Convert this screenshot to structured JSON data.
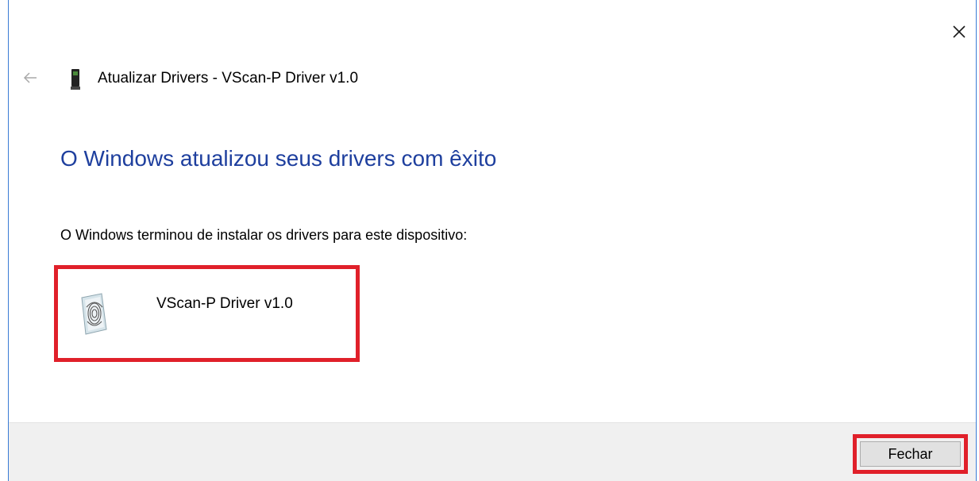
{
  "header": {
    "title": "Atualizar Drivers - VScan-P Driver v1.0"
  },
  "main": {
    "heading": "O Windows atualizou seus drivers com êxito",
    "description": "O Windows terminou de instalar os drivers para este dispositivo:",
    "device_name": "VScan-P Driver v1.0"
  },
  "footer": {
    "close_label": "Fechar"
  },
  "icons": {
    "back": "back-arrow-icon",
    "close": "close-icon",
    "device": "device-icon",
    "fingerprint": "fingerprint-icon"
  },
  "colors": {
    "heading": "#1e3f9e",
    "highlight": "#e0202a",
    "footer_bg": "#f0f0f0"
  }
}
